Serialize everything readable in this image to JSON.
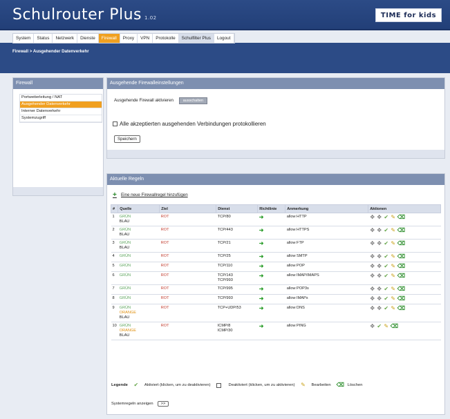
{
  "header": {
    "title": "Schulrouter Plus",
    "version": "1.02",
    "brand": "TIME for kids"
  },
  "menu": [
    "System",
    "Status",
    "Netzwerk",
    "Dienste",
    "Firewall",
    "Proxy",
    "VPN",
    "Protokolle",
    "Schulfilter Plus",
    "Logout"
  ],
  "breadcrumb": "Firewall  >  Ausgehender Datenverkehr",
  "left_panel": {
    "title": "Firewall",
    "items": [
      "Portweiterleitung / NAT",
      "Ausgehender Datenverkehr",
      "Interner Datenverkehr",
      "Systemzugriff"
    ]
  },
  "settings": {
    "title": "Ausgehende Firewalleinstellungen",
    "enable_label": "Ausgehende Firewall aktivieren",
    "toggle_label": "ausschalten",
    "log_label": "Alle akzeptierten ausgehenden Verbindungen protokollieren",
    "save_label": "Speichern"
  },
  "rules": {
    "title": "Aktuelle Regeln",
    "add_link": "Eine neue Firewallregel hinzufügen",
    "headers": [
      "#",
      "Quelle",
      "Ziel",
      "Dienst",
      "Richtlinie",
      "Anmerkung",
      "Aktionen"
    ],
    "rows": [
      {
        "n": "1",
        "src": [
          "GRÜN",
          "BLAU"
        ],
        "dst": "ROT",
        "service": [
          "TCP/80"
        ],
        "note": "allow HTTP"
      },
      {
        "n": "2",
        "src": [
          "GRÜN",
          "BLAU"
        ],
        "dst": "ROT",
        "service": [
          "TCP/443"
        ],
        "note": "allow HTTPS"
      },
      {
        "n": "3",
        "src": [
          "GRÜN",
          "BLAU"
        ],
        "dst": "ROT",
        "service": [
          "TCP/21"
        ],
        "note": "allow FTP"
      },
      {
        "n": "4",
        "src": [
          "GRÜN"
        ],
        "dst": "ROT",
        "service": [
          "TCP/25"
        ],
        "note": "allow SMTP"
      },
      {
        "n": "5",
        "src": [
          "GRÜN"
        ],
        "dst": "ROT",
        "service": [
          "TCP/110"
        ],
        "note": "allow POP"
      },
      {
        "n": "6",
        "src": [
          "GRÜN"
        ],
        "dst": "ROT",
        "service": [
          "TCP/143",
          "TCP/993"
        ],
        "note": "allow IMAP/IMAPS"
      },
      {
        "n": "7",
        "src": [
          "GRÜN"
        ],
        "dst": "ROT",
        "service": [
          "TCP/995"
        ],
        "note": "allow POP3s"
      },
      {
        "n": "8",
        "src": [
          "GRÜN"
        ],
        "dst": "ROT",
        "service": [
          "TCP/993"
        ],
        "note": "allow IMAPs"
      },
      {
        "n": "9",
        "src": [
          "GRÜN",
          "ORANGE",
          "BLAU"
        ],
        "dst": "ROT",
        "service": [
          "TCP+UDP/53"
        ],
        "note": "allow DNS"
      },
      {
        "n": "10",
        "src": [
          "GRÜN",
          "ORANGE",
          "BLAU"
        ],
        "dst": "ROT",
        "service": [
          "ICMP/8",
          "ICMP/30"
        ],
        "note": "allow PING"
      }
    ]
  },
  "legend": {
    "label": "Legende",
    "active": "Aktiviert (klicken, um zu deaktivieren)",
    "inactive": "Deaktiviert (klicken, um zu aktivieren)",
    "edit": "Bearbeiten",
    "delete": "Löschen"
  },
  "system_rules_label": "Systemregeln anzeigen",
  "system_rules_btn": ">>",
  "colors": {
    "header": "#2c4b86",
    "accent": "#f0a020",
    "green": "#5ea65e",
    "red": "#c0392b",
    "orange": "#e09010"
  }
}
